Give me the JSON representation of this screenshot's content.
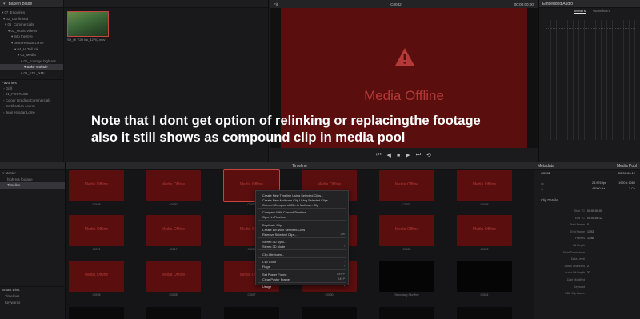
{
  "pool_header": {
    "title": "Bake n Blade"
  },
  "tree": [
    "07_Enquiries",
    "02_Confirmed",
    "01_Commercials",
    "02_Music videos",
    "Into the Eye",
    "Jean Hosaar Lome",
    "04_Hi Toll Ink",
    "01_Media",
    "01_Footage high-res",
    "Bake n Blade",
    "02_EDL_XML"
  ],
  "favorites": {
    "title": "Favorites",
    "items": [
      "Gixll",
      "01_FOOTAGE",
      "Colour Grading Commercials",
      "Certification course",
      "Jean Hosaar Lome"
    ]
  },
  "top_thumb": {
    "label": "SH_HI TOH Ink_42PIQ.mov"
  },
  "viewer": {
    "zoom": "Fit",
    "clip_name": "C0032",
    "timecode": "00:00:00:00",
    "offline_text": "Media Offline"
  },
  "audio": {
    "title": "Embedded Audio",
    "tab_meters": "Meters",
    "tab_waveform": "Waveform"
  },
  "bottom_left": {
    "master": "Master",
    "items": [
      "high-res footage",
      "Timeline"
    ],
    "smart_bins_title": "Smart Bins",
    "smart_bins": [
      "Timelines",
      "Keywords"
    ]
  },
  "pool_bar": {
    "title": "Timeline"
  },
  "grid": {
    "offline_text": "Media Offline",
    "row1": [
      "C0028",
      "C0030",
      "C0032",
      "C0033",
      "C0034",
      "C0035"
    ],
    "row2": [
      "C0071",
      "C0017",
      "C0035",
      "C0016",
      "C0020",
      "C0022"
    ],
    "row3": [
      "C0026",
      "C0028",
      "C0037",
      "C0030",
      "Secondary Storyline",
      "C0041"
    ]
  },
  "metadata": {
    "title": "Metadata",
    "pool_title": "Media Pool",
    "clip_name": "C0032",
    "clip_duration": "00:00:06:12",
    "fps": "23.976 fps",
    "resolution": "1920 x 1080",
    "audio_khz": "48000 Hz",
    "channels": "2 Ch",
    "section": "Clip Details",
    "fields": [
      {
        "k": "Start TC",
        "v": "00:00:00:00"
      },
      {
        "k": "End TC",
        "v": "00:00:06:12"
      },
      {
        "k": "Start Frame",
        "v": "0"
      },
      {
        "k": "End Frame",
        "v": "1393"
      },
      {
        "k": "Frames",
        "v": "1396"
      },
      {
        "k": "Bit Depth",
        "v": ""
      },
      {
        "k": "Field Dominance",
        "v": ""
      },
      {
        "k": "Data Level",
        "v": ""
      },
      {
        "k": "Audio Channels",
        "v": "2"
      },
      {
        "k": "Audio Bit Depth",
        "v": "32"
      },
      {
        "k": "Date Modified",
        "v": ""
      },
      {
        "k": "Keyword",
        "v": ""
      },
      {
        "k": "EDL Clip Name",
        "v": ""
      }
    ]
  },
  "context_menu": {
    "items": [
      "Create New Timeline Using Selected Clips...",
      "Create New Multicam Clip Using Selected Clips...",
      "Convert Compound Clip to Multicam Clip",
      "Compare With Current Timeline",
      "Open in Timeline",
      "Duplicate Clip",
      "Create Bin With Selected Clips",
      "Remove Selected Clips...",
      "Stereo 3D Sync...",
      "Stereo 3D Mode",
      "Clip Attributes...",
      "Clip Color",
      "Flags",
      "Set Poster Frame",
      "Clear Poster Frame",
      "Usage"
    ],
    "shortcuts": {
      "remove": "Del",
      "set_poster": "Ctrl+P",
      "clear_poster": "Alt+P"
    }
  },
  "annotation": {
    "line1": "Note that I dont get option of relinking or replacingthe footage",
    "line2": "also it still shows as compound clip in media pool"
  },
  "colors": {
    "offline_bg": "#5a0e0e",
    "offline_text": "#b33a38",
    "selection": "#c0463e"
  }
}
